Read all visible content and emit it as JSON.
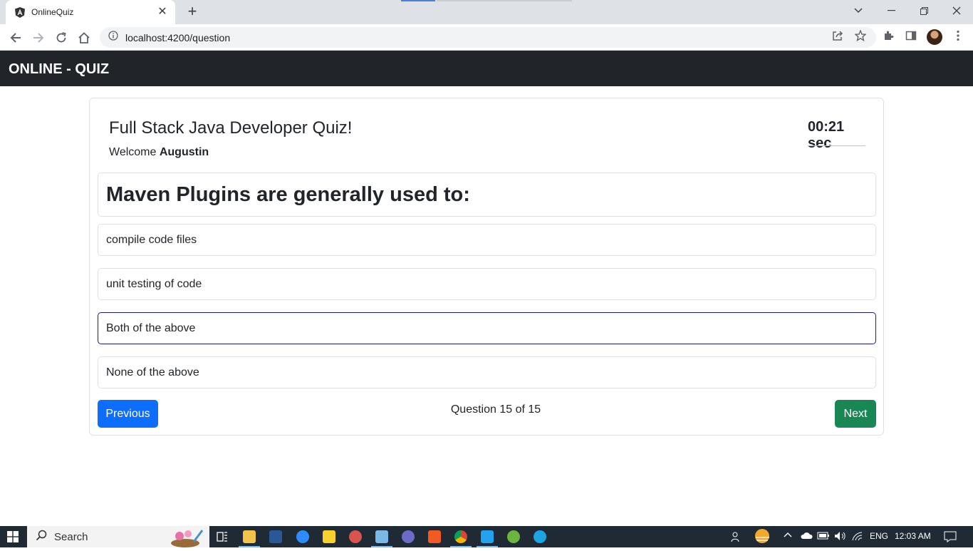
{
  "browser": {
    "tab_title": "OnlineQuiz",
    "url": "localhost:4200/question"
  },
  "navbar": {
    "brand": "ONLINE - QUIZ"
  },
  "quiz": {
    "title": "Full Stack Java Developer Quiz!",
    "welcome_prefix": "Welcome ",
    "user_name": "Augustin",
    "timer": "00:21 sec",
    "question": "Maven Plugins are generally used to:",
    "options": [
      {
        "text": "compile code files",
        "selected": false
      },
      {
        "text": "unit testing of code",
        "selected": false
      },
      {
        "text": "Both of the above",
        "selected": true
      },
      {
        "text": "None of the above",
        "selected": false
      }
    ],
    "previous_label": "Previous",
    "next_label": "Next",
    "counter": "Question 15 of 15"
  },
  "taskbar": {
    "search_label": "Search",
    "language": "ENG",
    "time": "12:03 AM"
  },
  "colors": {
    "navbar_bg": "#212529",
    "previous_btn": "#0d6efd",
    "next_btn": "#198754",
    "selected_border": "#1a1a8c"
  }
}
